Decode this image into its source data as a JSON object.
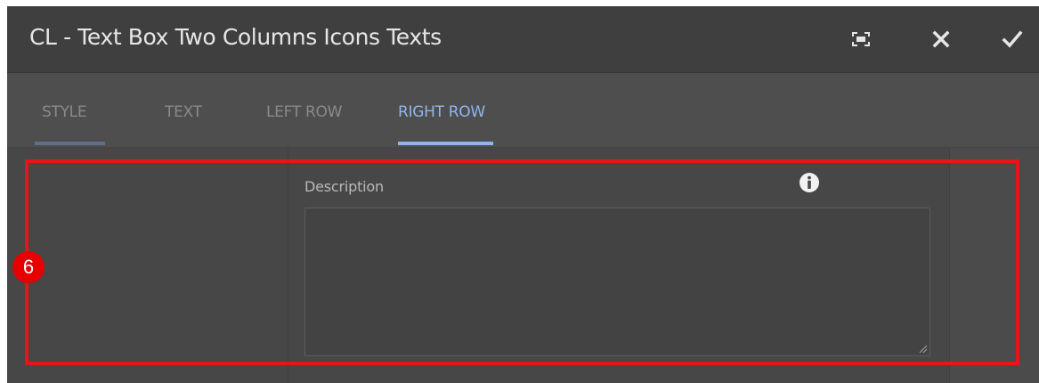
{
  "dialog": {
    "title": "CL - Text Box Two Columns Icons Texts",
    "actions": {
      "fullscreen_icon": "fullscreen-icon",
      "close_icon": "close-icon",
      "confirm_icon": "checkmark-icon"
    }
  },
  "tabs": [
    {
      "label": "STYLE",
      "active": false
    },
    {
      "label": "TEXT",
      "active": false
    },
    {
      "label": "LEFT ROW",
      "active": false
    },
    {
      "label": "RIGHT ROW",
      "active": true
    }
  ],
  "form": {
    "description_label": "Description",
    "description_value": "",
    "info_icon": "info-icon"
  },
  "annotation": {
    "number": "6",
    "color": "#e8131b"
  },
  "colors": {
    "header_bg": "#3f3f3f",
    "panel_bg": "#4b4b4b",
    "accent_tab": "#8fb6ee",
    "inactive_tab_underline": "#5e6f87"
  }
}
